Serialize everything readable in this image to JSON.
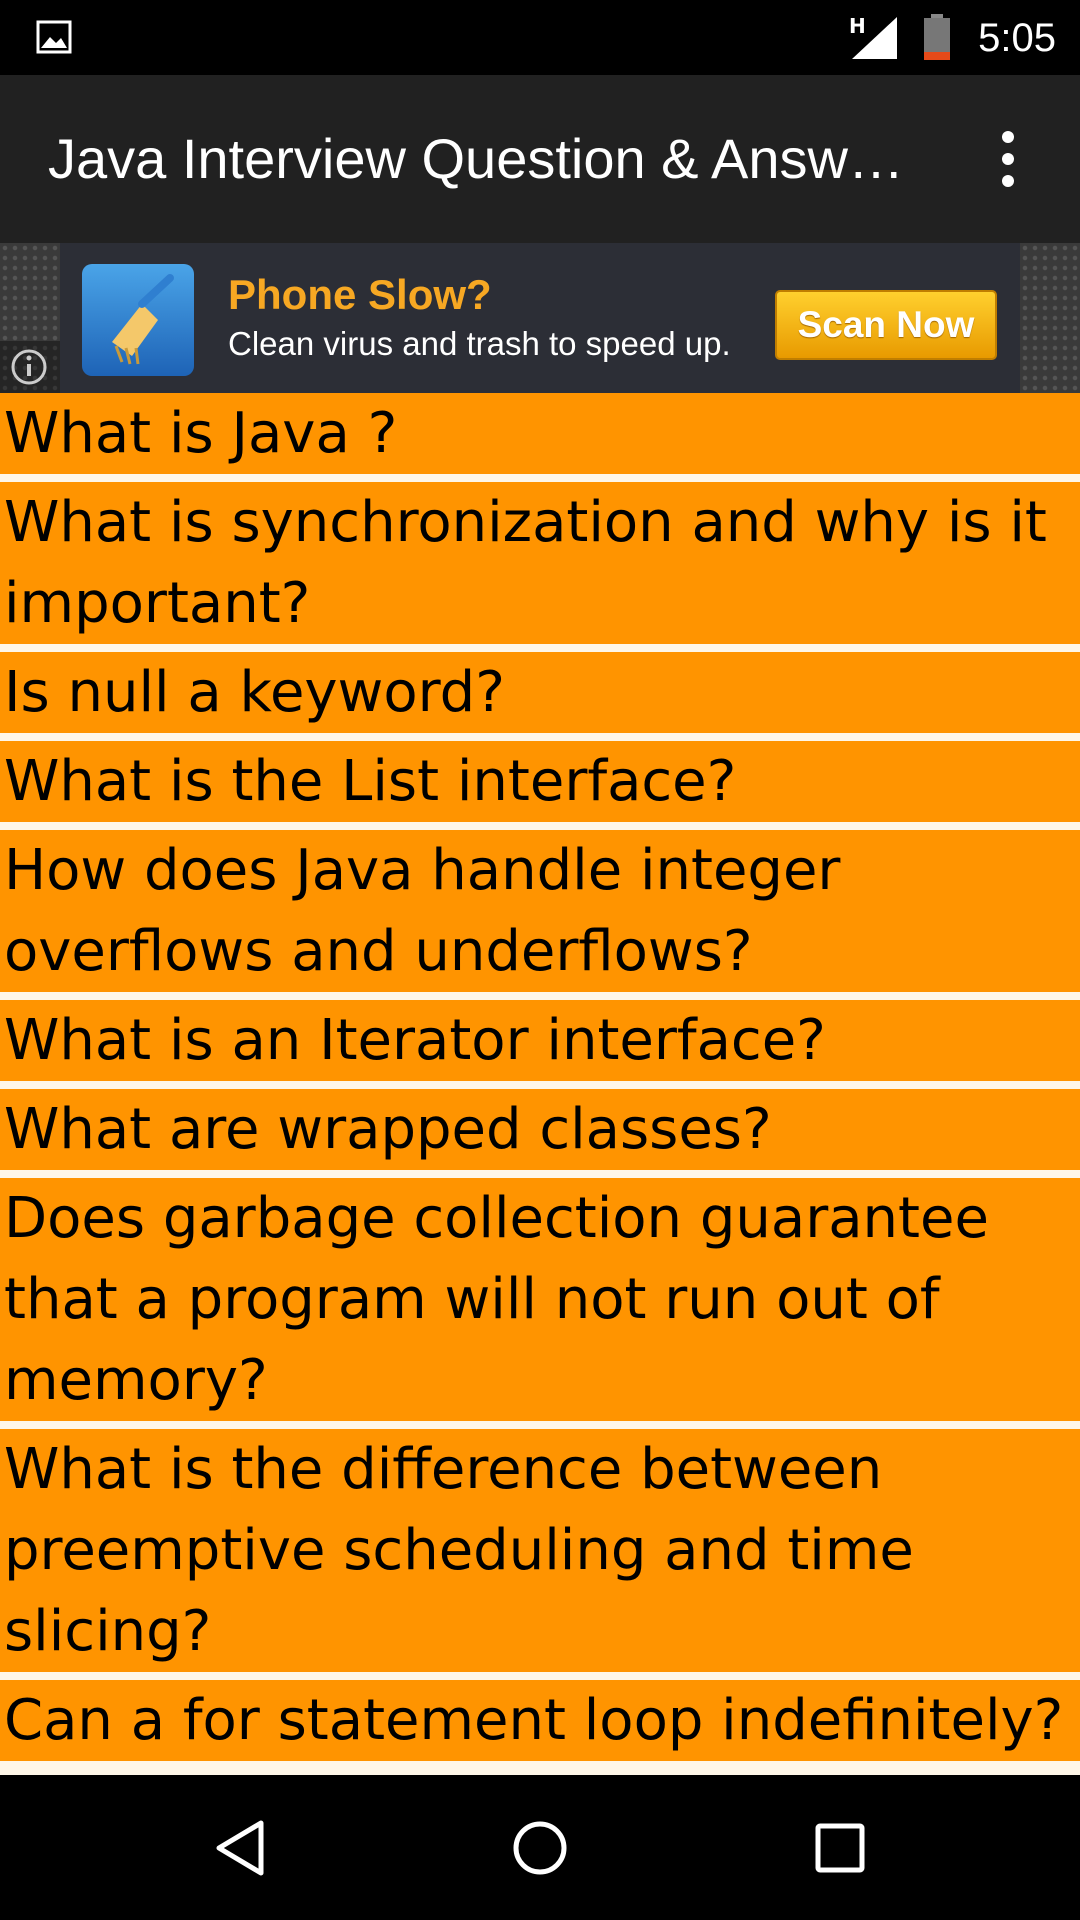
{
  "status_bar": {
    "network_label": "H",
    "time": "5:05",
    "icons": [
      "gallery-icon",
      "signal-icon",
      "battery-icon"
    ],
    "battery_level": 0.15
  },
  "app_bar": {
    "title": "Java Interview Question & Answ…",
    "menu_icon": "overflow-menu-icon"
  },
  "ad": {
    "headline": "Phone Slow?",
    "subline": "Clean virus and trash to speed up.",
    "button_label": "Scan Now",
    "icons": [
      "broom-app-icon",
      "info-icon"
    ]
  },
  "questions": [
    "What is Java ?",
    "What is synchronization and why is it important?",
    "Is null a keyword?",
    "What is the List interface?",
    "How does Java handle integer overflows and underflows?",
    "What is an Iterator interface?",
    "What are wrapped classes?",
    "Does garbage collection guarantee that a program will not run out of memory?",
    "What is the difference between preemptive scheduling and time slicing?",
    "Can a for statement loop indefinitely?"
  ],
  "nav_bar": {
    "icons": [
      "back-icon",
      "home-icon",
      "recents-icon"
    ]
  },
  "colors": {
    "list_item_bg": "#ff9400",
    "app_bar_bg": "#212121",
    "ad_headline": "#f7a823"
  }
}
